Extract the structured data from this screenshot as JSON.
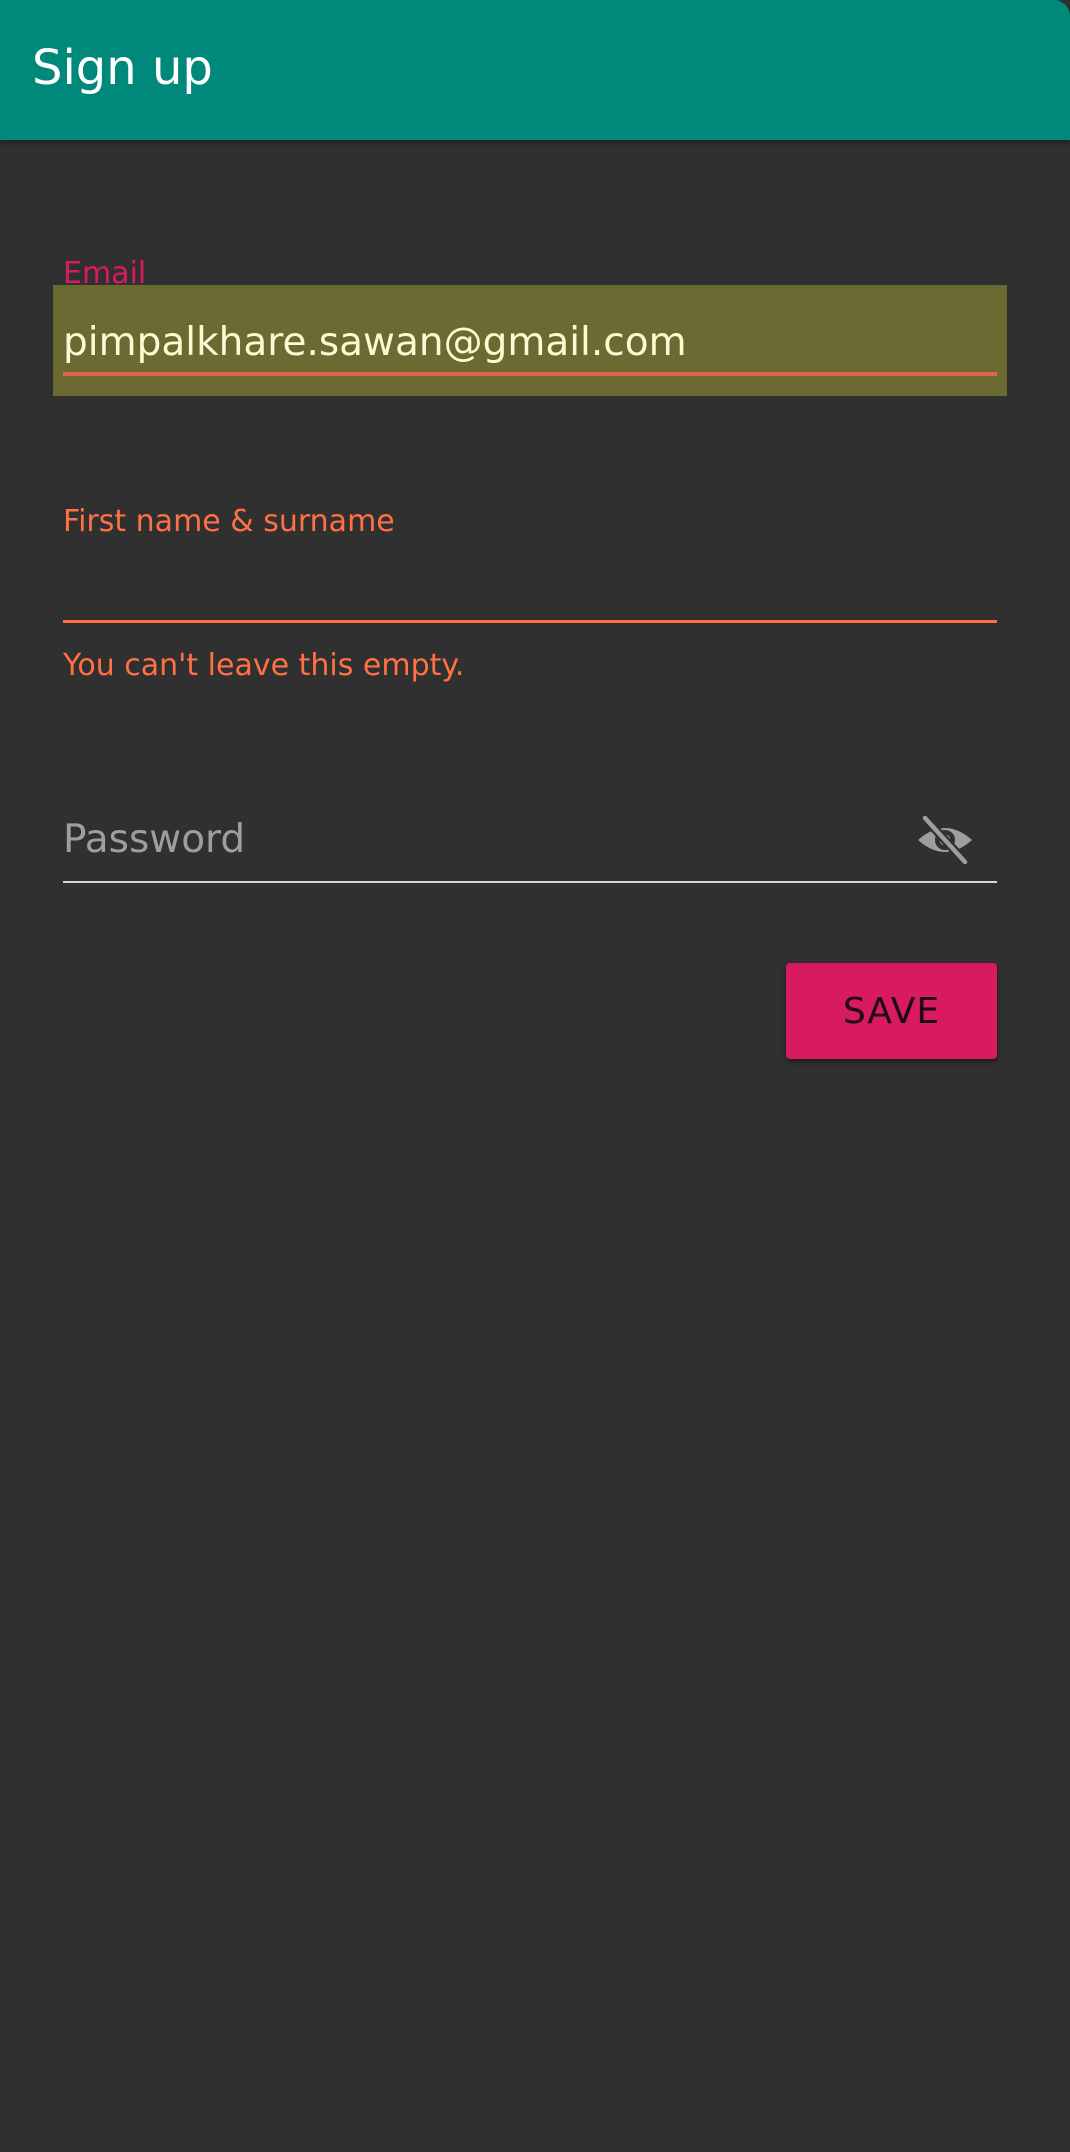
{
  "app_bar": {
    "title": "Sign up",
    "color": "#00897B"
  },
  "form": {
    "email": {
      "label": "Email",
      "value": "pimpalkhare.sawan@gmail.com",
      "label_color": "#D81B60",
      "highlight_color": "#6B6A33"
    },
    "name": {
      "label": "First name & surname",
      "value": "",
      "error": "You can't leave this empty.",
      "error_color": "#FF7043"
    },
    "password": {
      "placeholder": "Password",
      "value": "",
      "toggle_icon": "visibility-off-icon"
    },
    "save_label": "SAVE",
    "save_color": "#D81B60"
  },
  "background_color": "#303030"
}
